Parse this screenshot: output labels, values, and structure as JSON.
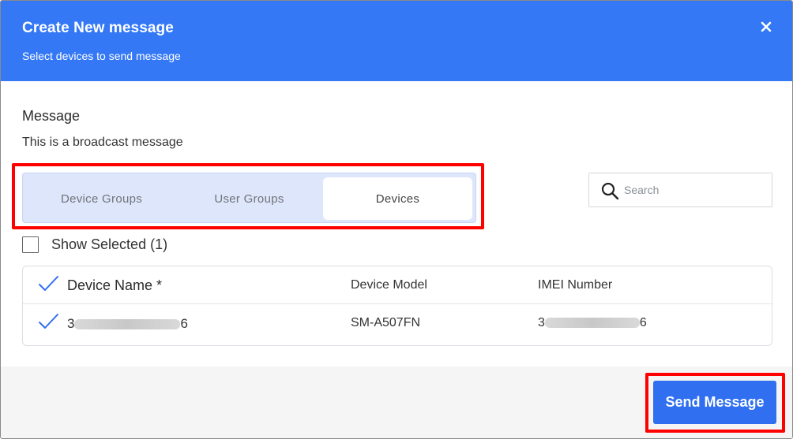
{
  "header": {
    "title": "Create New message",
    "subtitle": "Select devices to send message",
    "close_icon": "close-icon"
  },
  "message": {
    "label": "Message",
    "text": "This is a broadcast message"
  },
  "tabs": [
    {
      "label": "Device Groups",
      "selected": false
    },
    {
      "label": "User Groups",
      "selected": false
    },
    {
      "label": "Devices",
      "selected": true
    }
  ],
  "search": {
    "placeholder": "Search",
    "value": ""
  },
  "show_selected": {
    "label": "Show Selected (1)",
    "checked": false
  },
  "table": {
    "columns": [
      "Device Name *",
      "Device Model",
      "IMEI Number"
    ],
    "rows": [
      {
        "device_name_prefix": "3",
        "device_name_suffix": "6",
        "device_model": "SM-A507FN",
        "imei_prefix": "3",
        "imei_suffix": "6",
        "selected": true
      }
    ]
  },
  "footer": {
    "send_label": "Send Message"
  },
  "colors": {
    "header_bg": "#3478f6",
    "primary_button": "#2f6ff0",
    "highlight": "#ff0000",
    "check": "#2f6ff0"
  }
}
